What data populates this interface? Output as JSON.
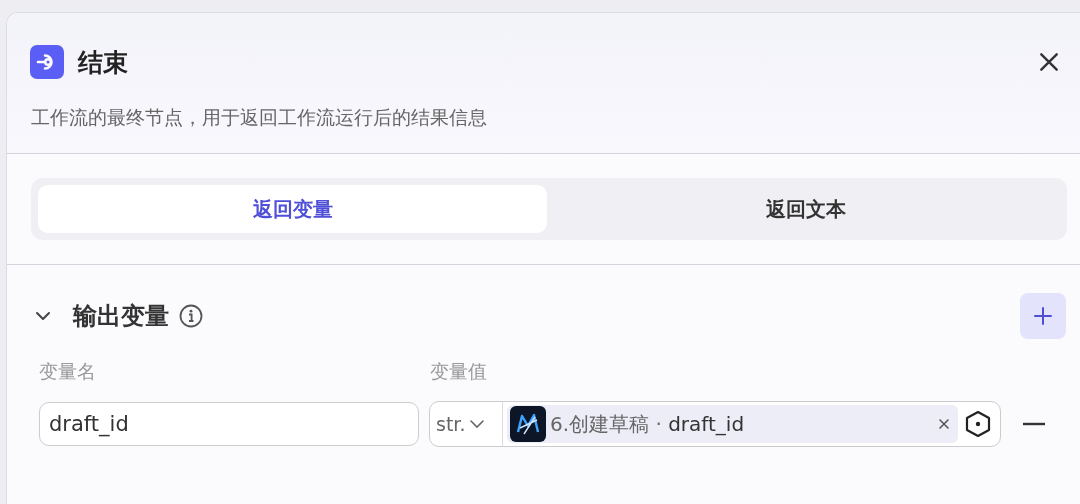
{
  "node": {
    "title": "结束",
    "description": "工作流的最终节点，用于返回工作流运行后的结果信息"
  },
  "tabs": [
    {
      "label": "返回变量",
      "selected": true
    },
    {
      "label": "返回文本",
      "selected": false
    }
  ],
  "section": {
    "title": "输出变量",
    "expanded": true
  },
  "columns": [
    "变量名",
    "变量值"
  ],
  "rows": [
    {
      "name": "draft_id",
      "type": "str.",
      "reference": "6.创建草稿 · **draft_id**"
    }
  ]
}
